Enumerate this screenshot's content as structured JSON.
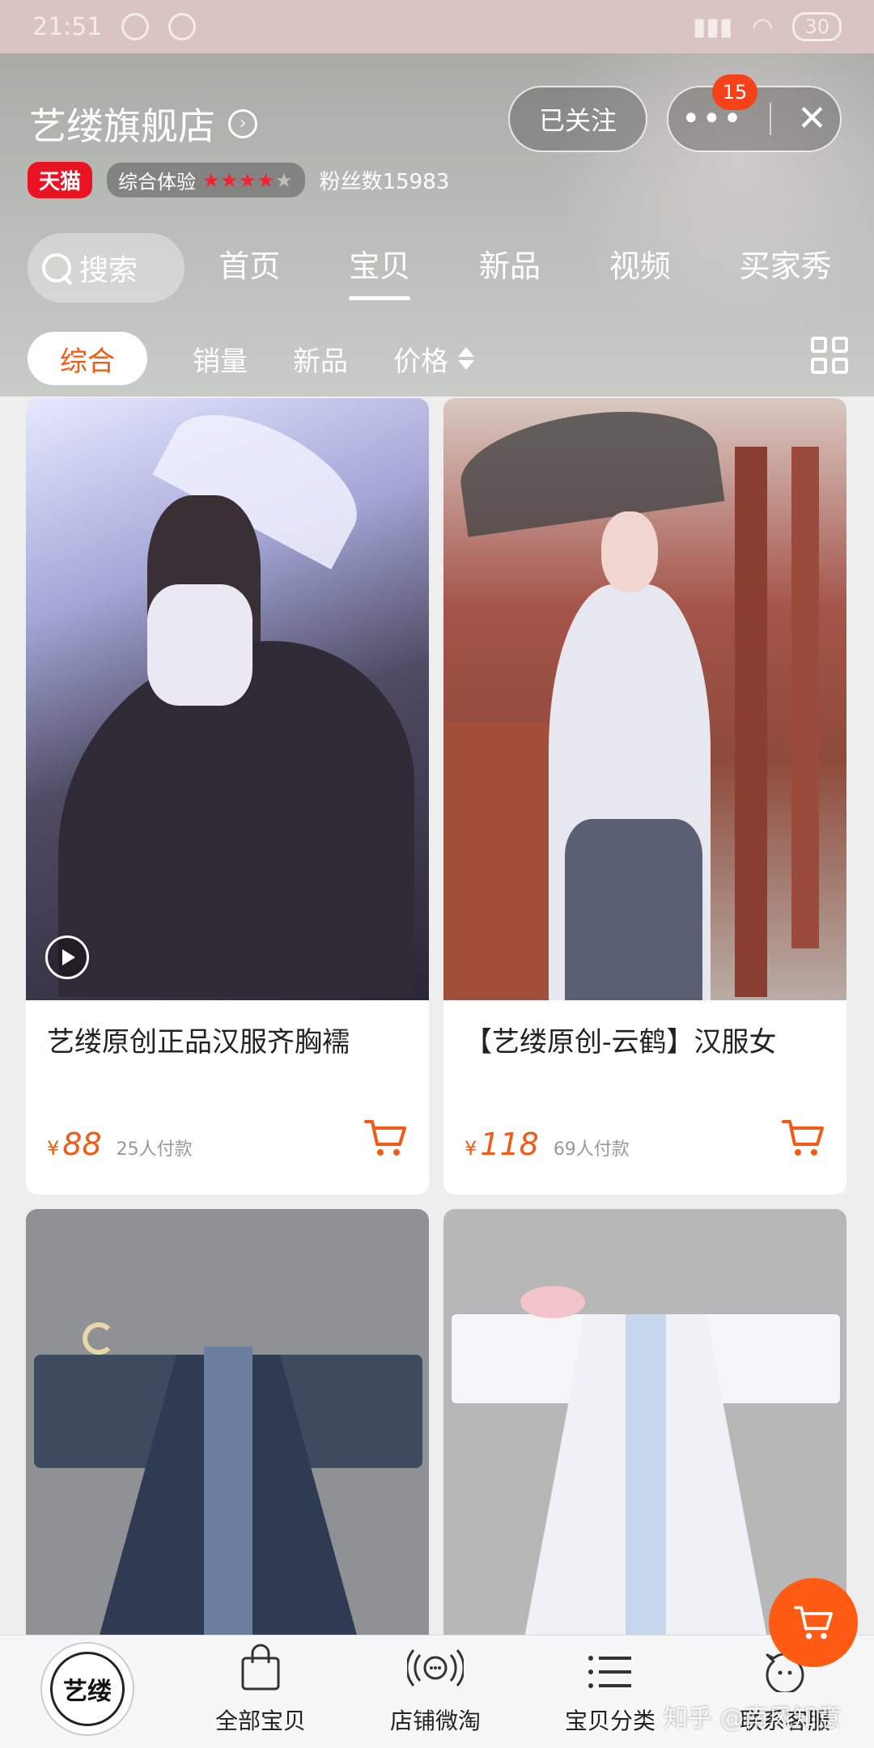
{
  "status_bar": {
    "time": "21:51",
    "battery": "30"
  },
  "shop": {
    "name": "艺缕旗舰店",
    "tmall_tag": "天猫",
    "rating_label": "综合体验",
    "fans_label": "粉丝数15983",
    "follow_label": "已关注",
    "notification_count": "15"
  },
  "search": {
    "label": "搜索"
  },
  "nav_tabs": [
    {
      "label": "首页"
    },
    {
      "label": "宝贝"
    },
    {
      "label": "新品"
    },
    {
      "label": "视频"
    },
    {
      "label": "买家秀"
    }
  ],
  "filters": {
    "active": "综合",
    "sales": "销量",
    "new": "新品",
    "price": "价格"
  },
  "products": [
    {
      "title": "艺缕原创正品汉服齐胸襦",
      "currency": "¥",
      "price": "88",
      "sales": "25人付款"
    },
    {
      "title": "【艺缕原创-云鹤】汉服女",
      "currency": "¥",
      "price": "118",
      "sales": "69人付款"
    },
    {
      "title": "",
      "currency": "",
      "price": "",
      "sales": ""
    },
    {
      "title": "",
      "currency": "",
      "price": "",
      "sales": ""
    }
  ],
  "bottom_nav": {
    "logo_text": "艺缕",
    "items": [
      {
        "label": "全部宝贝"
      },
      {
        "label": "店铺微淘"
      },
      {
        "label": "宝贝分类"
      },
      {
        "label": "联系客服"
      }
    ]
  },
  "watermark": "知乎 @南风知意",
  "colors": {
    "accent": "#f25a16",
    "tmall_red": "#e91323",
    "badge": "#f5421b"
  }
}
